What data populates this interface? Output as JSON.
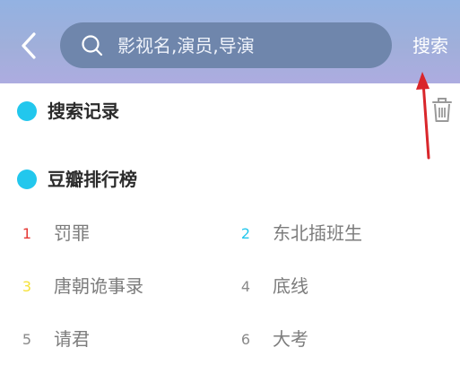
{
  "header": {
    "back_icon": "chevron-left-icon",
    "search": {
      "icon": "search-icon",
      "placeholder": "影视名,演员,导演",
      "value": ""
    },
    "search_button_label": "搜索",
    "background_color": "#a0afda",
    "search_box_color": "#6f86ac"
  },
  "history": {
    "title": "搜索记录",
    "clear_icon": "trash-icon"
  },
  "ranking": {
    "title": "豆瓣排行榜",
    "items": [
      {
        "rank": "1",
        "title": "罚罪",
        "rank_color": "#e53935"
      },
      {
        "rank": "2",
        "title": "东北插班生",
        "rank_color": "#22c7ed"
      },
      {
        "rank": "3",
        "title": "唐朝诡事录",
        "rank_color": "#f5e23a"
      },
      {
        "rank": "4",
        "title": "底线",
        "rank_color": "#8a8a8a"
      },
      {
        "rank": "5",
        "title": "请君",
        "rank_color": "#8a8a8a"
      },
      {
        "rank": "6",
        "title": "大考",
        "rank_color": "#8a8a8a"
      }
    ]
  },
  "accent_color": "#22c7ed",
  "annotation_color": "#d9262b"
}
